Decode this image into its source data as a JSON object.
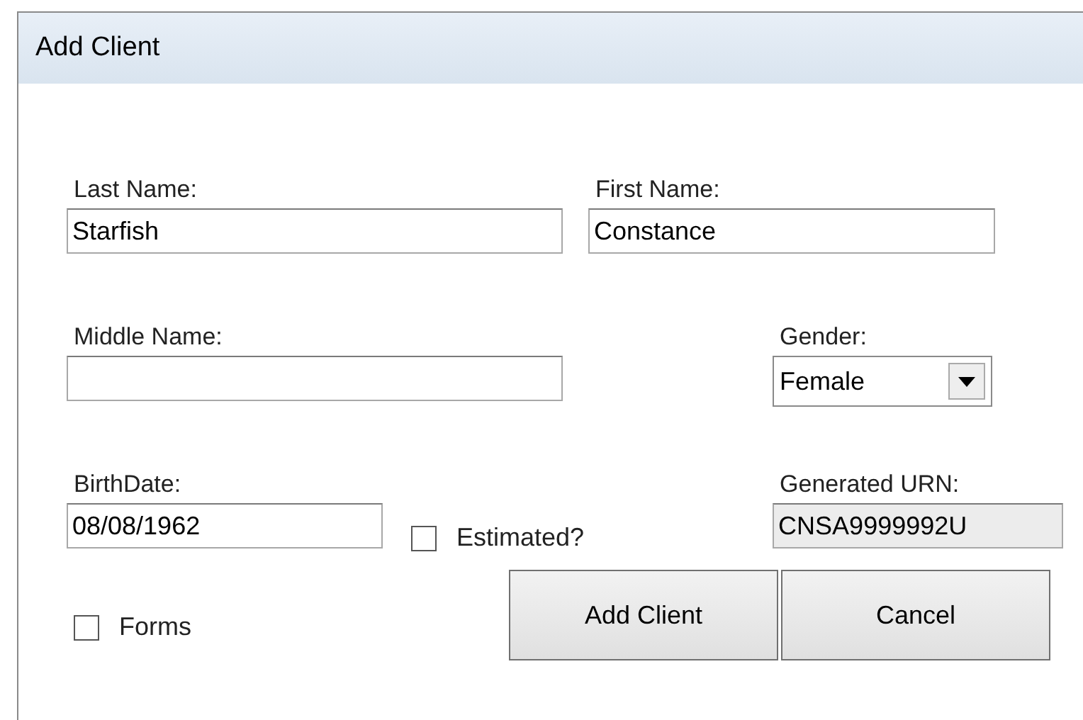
{
  "window": {
    "title": "Add Client"
  },
  "last_name": {
    "label": "Last Name:",
    "value": "Starfish"
  },
  "first_name": {
    "label": "First Name:",
    "value": "Constance"
  },
  "middle_name": {
    "label": "Middle Name:"
  },
  "gender": {
    "label": "Gender:",
    "value": "Female"
  },
  "birthdate": {
    "label": "BirthDate:",
    "value": "08/08/1962"
  },
  "estimated": {
    "label": "Estimated?",
    "checked": false
  },
  "urn": {
    "label": "Generated URN:",
    "value": "CNSA9999992U"
  },
  "forms": {
    "label": "Forms",
    "checked": false
  },
  "buttons": [
    "Add Client",
    "Cancel"
  ]
}
